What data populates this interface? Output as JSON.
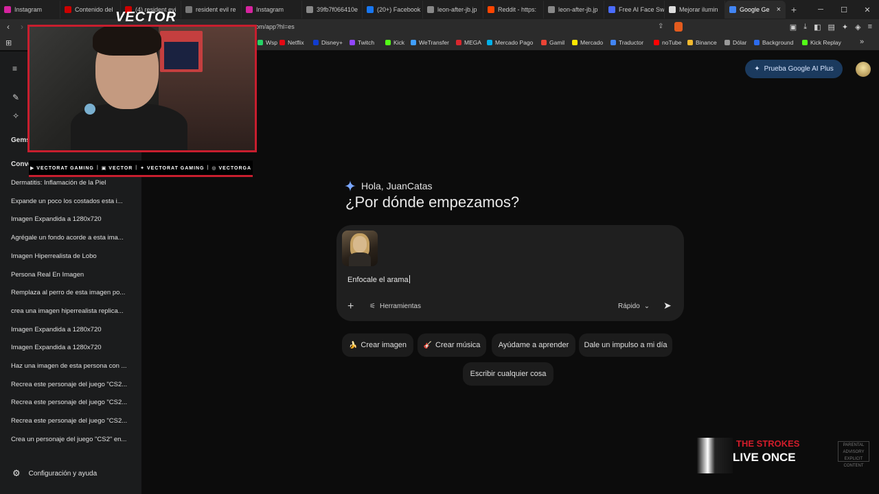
{
  "browser": {
    "tabs": [
      {
        "label": "Instagram",
        "color": "#d6249f"
      },
      {
        "label": "Contenido del",
        "color": "#cc0000"
      },
      {
        "label": "(4) resident evi",
        "color": "#cc0000"
      },
      {
        "label": "resident evil re",
        "color": "#777777"
      },
      {
        "label": "Instagram",
        "color": "#d6249f"
      },
      {
        "label": "39fb7f066410e",
        "color": "#888888"
      },
      {
        "label": "(20+) Facebook",
        "color": "#1877f2"
      },
      {
        "label": "leon-after-jb.jp",
        "color": "#888888"
      },
      {
        "label": "Reddit - https:",
        "color": "#ff4500"
      },
      {
        "label": "leon-after-jb.jp",
        "color": "#888888"
      },
      {
        "label": "Free AI Face Sw",
        "color": "#4a6cff"
      },
      {
        "label": "Mejorar ilumin",
        "color": "#dddddd"
      },
      {
        "label": "Google Ge",
        "color": "#4285f4",
        "active": true
      }
    ],
    "url": "om/app?hl=es",
    "bookmarks": [
      {
        "label": "Wsp",
        "color": "#25d366"
      },
      {
        "label": "Netflix",
        "color": "#e50914"
      },
      {
        "label": "Disney+",
        "color": "#113ccf"
      },
      {
        "label": "Twitch",
        "color": "#9146ff"
      },
      {
        "label": "Kick",
        "color": "#53fc18"
      },
      {
        "label": "WeTransfer",
        "color": "#409fff"
      },
      {
        "label": "MEGA",
        "color": "#d9272e"
      },
      {
        "label": "Mercado Pago",
        "color": "#00b1ea"
      },
      {
        "label": "Gamil",
        "color": "#ea4335"
      },
      {
        "label": "Mercado",
        "color": "#ffe600"
      },
      {
        "label": "Traductor",
        "color": "#4285f4"
      },
      {
        "label": "noTube",
        "color": "#ff0000"
      },
      {
        "label": "Binance",
        "color": "#f3ba2f"
      },
      {
        "label": "Dólar",
        "color": "#999999"
      },
      {
        "label": "Background",
        "color": "#2c6bed"
      },
      {
        "label": "Kick Replay",
        "color": "#53fc18"
      }
    ]
  },
  "sidebar": {
    "gems_label": "Gems",
    "conversations_label": "Conve",
    "conversations": [
      "Dermatitis: Inflamación de la Piel",
      "Expande un poco los costados esta i...",
      "Imagen Expandida a 1280x720",
      "Agrégale un fondo acorde a esta ima...",
      "Imagen Hiperrealista de Lobo",
      "Persona Real En Imagen",
      "Remplaza al perro de esta imagen po...",
      "crea una imagen hiperrealista replica...",
      "Imagen Expandida a 1280x720",
      "Imagen Expandida a 1280x720",
      "Haz una imagen de esta persona con ...",
      "Recrea este personaje del juego \"CS2...",
      "Recrea este personaje del juego \"CS2...",
      "Recrea este personaje del juego \"CS2...",
      "Crea un personaje del juego \"CS2\" en..."
    ],
    "settings_label": "Configuración y ayuda"
  },
  "main": {
    "promo_label": "Prueba Google AI Plus",
    "greeting": "Hola, JuanCatas",
    "headline": "¿Por dónde empezamos?",
    "prompt_text": "Enfocale el arama",
    "tools_label": "Herramientas",
    "mode_label": "Rápido",
    "chips": [
      {
        "icon": "🍌",
        "label": "Crear imagen"
      },
      {
        "icon": "🎸",
        "label": "Crear música"
      },
      {
        "icon": "",
        "label": "Ayúdame a aprender"
      },
      {
        "icon": "",
        "label": "Dale un impulso a mi día"
      },
      {
        "icon": "",
        "label": "Escribir cualquier cosa"
      }
    ]
  },
  "overlay": {
    "cam_logo": "VECTOR",
    "socials": [
      {
        "icon": "youtube-icon",
        "label": "VECTORAT GAMING"
      },
      {
        "icon": "twitch-icon",
        "label": "VECTOR"
      },
      {
        "icon": "twitter-icon",
        "label": "VECTORAT GAMING"
      },
      {
        "icon": "instagram-icon",
        "label": "VECTORGA"
      }
    ],
    "now_playing": {
      "band": "THE STROKES",
      "song": "LIVE ONCE",
      "advisory": "PARENTAL ADVISORY EXPLICIT CONTENT"
    }
  }
}
